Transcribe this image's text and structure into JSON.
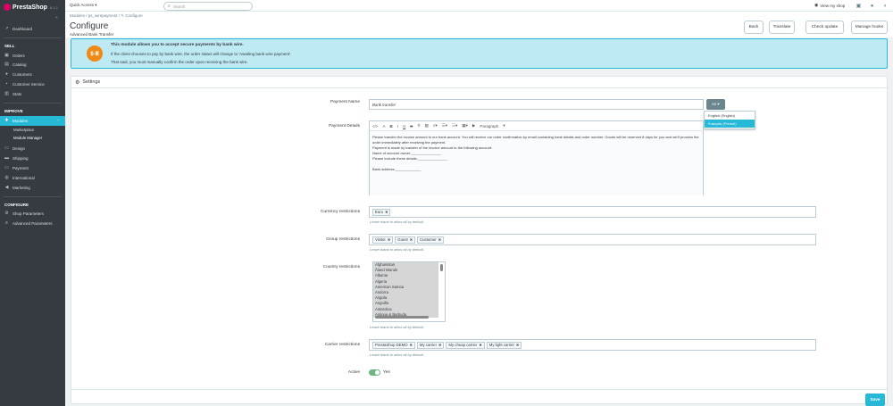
{
  "brand": {
    "name": "PrestaShop",
    "version": "8.1.2"
  },
  "topbar": {
    "quick_access": "Quick Access ▾",
    "search_placeholder": "Search",
    "view_shop": "View my shop"
  },
  "sidebar": {
    "collapse": "«",
    "dashboard": "Dashboard",
    "sell_title": "SELL",
    "sell_items": [
      "Orders",
      "Catalog",
      "Customers",
      "Customer Service",
      "Stats"
    ],
    "improve_title": "IMPROVE",
    "modules": "Modules",
    "module_subitems": [
      "Marketplace",
      "Module Manager"
    ],
    "improve_items": [
      "Design",
      "Shipping",
      "Payment",
      "International",
      "Marketing"
    ],
    "configure_title": "CONFIGURE",
    "configure_items": [
      "Shop Parameters",
      "Advanced Parameters"
    ]
  },
  "header": {
    "breadcrumb": "Modules  /  ps_wirepayment  /  ✎ Configure",
    "title": "Configure",
    "subtitle": "Advanced Bank Transfer",
    "buttons": {
      "back": "Back",
      "translate": "Translate",
      "check_update": "Check update",
      "manage_hooks": "Manage hooks"
    }
  },
  "info": {
    "logo": "$-Ⅲ",
    "line1": "This module allows you to accept secure payments by bank wire.",
    "line2": "If the client chooses to pay by bank wire, the order status will change to 'Awaiting bank wire payment'.",
    "line3": "That said, you must manually confirm the order upon receiving the bank wire."
  },
  "settings": {
    "title": "Settings",
    "payment_name_label": "Payment Name",
    "payment_name_value": "Bank transfer",
    "lang_button": "en ▾",
    "languages": [
      "English (English)",
      "Français (French)"
    ],
    "payment_details_label": "Payment Details",
    "editor_paragraph": "Paragraph",
    "editor_lines": [
      "Please transfer the invoice amount to our bank account. You will receive our order confirmation by email containing bank details and order number. Goods will be reserved 8 days for you and we'll process the order immediately after receiving the payment.",
      "Payment is made by transfer of the invoice amount to the following account:",
      "Name of account owner:_______________",
      "Please include these details:_______________",
      "",
      "Bank address:_____________"
    ],
    "currency_label": "Currency restrictions",
    "currency_tags": [
      "Euro"
    ],
    "group_label": "Group restrictions",
    "group_tags": [
      "Visitor",
      "Guest",
      "Customer"
    ],
    "country_label": "Country restrictions",
    "countries": [
      "Afghanistan",
      "Åland Islands",
      "Albania",
      "Algeria",
      "American Samoa",
      "Andorra",
      "Angola",
      "Anguilla",
      "Antarctica",
      "Antigua & Barbuda"
    ],
    "carrier_label": "Carrier restrictions",
    "carrier_tags": [
      "PrestaShop DEMO",
      "My carrier",
      "My cheap carrier",
      "My light carrier"
    ],
    "help": "Leave blank to allow all by default.",
    "active_label": "Active",
    "active_value": "Yes",
    "save": "Save"
  }
}
